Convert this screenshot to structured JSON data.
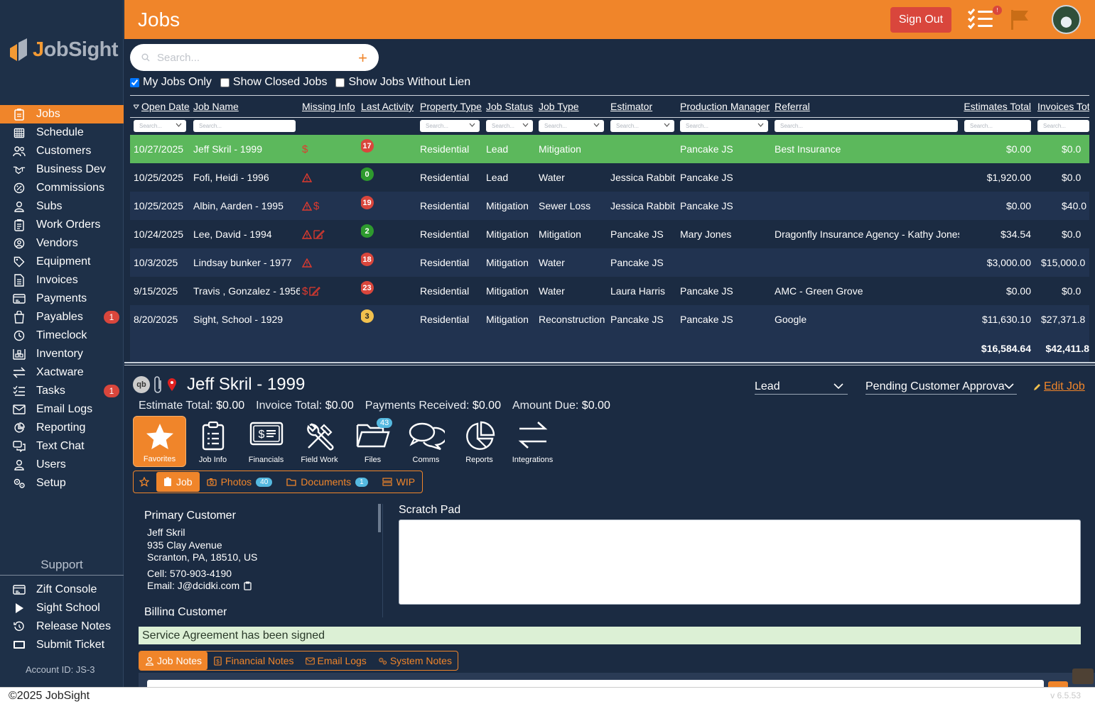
{
  "app": {
    "logo_text": "JobSight",
    "page_title": "Jobs"
  },
  "header": {
    "sign_out": "Sign Out",
    "tasks_badge": "!"
  },
  "sidebar": {
    "items": [
      {
        "label": "Jobs",
        "icon": "clipboard-icon",
        "active": true
      },
      {
        "label": "Schedule",
        "icon": "calendar-icon"
      },
      {
        "label": "Customers",
        "icon": "users-icon"
      },
      {
        "label": "Business Dev",
        "icon": "handshake-icon"
      },
      {
        "label": "Commissions",
        "icon": "percent-icon"
      },
      {
        "label": "Subs",
        "icon": "user-icon"
      },
      {
        "label": "Work Orders",
        "icon": "clipboard-list-icon"
      },
      {
        "label": "Vendors",
        "icon": "user-circle-icon"
      },
      {
        "label": "Equipment",
        "icon": "tag-icon"
      },
      {
        "label": "Invoices",
        "icon": "document-icon"
      },
      {
        "label": "Payments",
        "icon": "card-icon"
      },
      {
        "label": "Payables",
        "icon": "bag-icon",
        "badge": "1"
      },
      {
        "label": "Timeclock",
        "icon": "clock-icon"
      },
      {
        "label": "Inventory",
        "icon": "warehouse-icon"
      },
      {
        "label": "Xactware",
        "icon": "arrows-icon"
      },
      {
        "label": "Tasks",
        "icon": "list-icon",
        "badge": "1"
      },
      {
        "label": "Email Logs",
        "icon": "mail-icon"
      },
      {
        "label": "Reporting",
        "icon": "chart-pie-icon"
      },
      {
        "label": "Text Chat",
        "icon": "chat-icon"
      },
      {
        "label": "Users",
        "icon": "user-icon"
      },
      {
        "label": "Setup",
        "icon": "gears-icon"
      }
    ],
    "support_title": "Support",
    "support_items": [
      {
        "label": "Zift Console",
        "icon": "card-icon"
      },
      {
        "label": "Sight School",
        "icon": "play-icon"
      },
      {
        "label": "Release Notes",
        "icon": "history-icon"
      },
      {
        "label": "Submit Ticket",
        "icon": "monitor-icon"
      }
    ],
    "account_id": "Account ID:  JS-3"
  },
  "search": {
    "placeholder": "Search..."
  },
  "filters": [
    {
      "label": "My Jobs Only",
      "checked": true
    },
    {
      "label": "Show Closed Jobs",
      "checked": false
    },
    {
      "label": "Show Jobs Without Lien",
      "checked": false
    }
  ],
  "table": {
    "columns": [
      "Open Date",
      "Job Name",
      "Missing Info",
      "Last Activity",
      "Property Type",
      "Job Status",
      "Job Type",
      "Estimator",
      "Production Manager",
      "Referral",
      "Estimates Total",
      "Invoices Tot"
    ],
    "search_placeholder": "Search...",
    "rows": [
      {
        "date": "10/27/2025",
        "name": "Jeff Skril - 1999",
        "missing": [
          "dollar"
        ],
        "activity": "17",
        "activity_color": "#d9463c",
        "property": "Residential",
        "status": "Lead",
        "type": "Mitigation",
        "estimator": "",
        "pm": "Pancake JS",
        "referral": "Best Insurance",
        "estimates": "$0.00",
        "invoices": "$0.0",
        "selected": true
      },
      {
        "date": "10/25/2025",
        "name": "Fofi, Heidi - 1996",
        "missing": [
          "warn"
        ],
        "activity": "0",
        "activity_color": "#2e9a2e",
        "property": "Residential",
        "status": "Lead",
        "type": "Water",
        "estimator": "Jessica Rabbit",
        "pm": "Pancake JS",
        "referral": "",
        "estimates": "$1,920.00",
        "invoices": "$0.0"
      },
      {
        "date": "10/25/2025",
        "name": "Albin, Aarden - 1995",
        "missing": [
          "warn",
          "dollar"
        ],
        "activity": "19",
        "activity_color": "#d9463c",
        "property": "Residential",
        "status": "Mitigation",
        "type": "Sewer Loss",
        "estimator": "Jessica Rabbit",
        "pm": "Pancake JS",
        "referral": "",
        "estimates": "$0.00",
        "invoices": "$40.0"
      },
      {
        "date": "10/24/2025",
        "name": "Lee, David - 1994",
        "missing": [
          "warn",
          "sign"
        ],
        "activity": "2",
        "activity_color": "#2e9a2e",
        "property": "Residential",
        "status": "Mitigation",
        "type": "Mitigation",
        "estimator": "Pancake JS",
        "pm": "Mary Jones",
        "referral": "Dragonfly Insurance Agency - Kathy Jones",
        "estimates": "$34.54",
        "invoices": "$0.0"
      },
      {
        "date": "10/3/2025",
        "name": "Lindsay bunker - 1977",
        "missing": [
          "warn"
        ],
        "activity": "18",
        "activity_color": "#d9463c",
        "property": "Residential",
        "status": "Mitigation",
        "type": "Water",
        "estimator": "Pancake JS",
        "pm": "",
        "referral": "",
        "estimates": "$3,000.00",
        "invoices": "$15,000.0"
      },
      {
        "date": "9/15/2025",
        "name": "Travis , Gonzalez - 1956",
        "missing": [
          "dollar",
          "sign"
        ],
        "activity": "23",
        "activity_color": "#d9463c",
        "property": "Residential",
        "status": "Mitigation",
        "type": "Water",
        "estimator": "Laura Harris",
        "pm": "Pancake JS",
        "referral": "AMC - Green Grove",
        "estimates": "$0.00",
        "invoices": "$0.0"
      },
      {
        "date": "8/20/2025",
        "name": "Sight, School - 1929",
        "missing": [],
        "activity": "3",
        "activity_color": "#f2c14e",
        "property": "Residential",
        "status": "Mitigation",
        "type": "Reconstruction",
        "estimator": "Pancake JS",
        "pm": "Pancake JS",
        "referral": "Google",
        "estimates": "$11,630.10",
        "invoices": "$27,371.8"
      }
    ],
    "totals": {
      "estimates": "$16,584.64",
      "invoices": "$42,411.8"
    }
  },
  "detail": {
    "title": "Jeff Skril - 1999",
    "status": "Lead",
    "substatus": "Pending Customer Approva",
    "edit_job": "Edit Job",
    "money": [
      {
        "label": "Estimate Total:",
        "value": "$0.00"
      },
      {
        "label": "Invoice Total:",
        "value": "$0.00"
      },
      {
        "label": "Payments Received:",
        "value": "$0.00"
      },
      {
        "label": "Amount Due:",
        "value": "$0.00"
      }
    ],
    "icon_tabs": [
      {
        "label": "Favorites",
        "icon": "star-icon"
      },
      {
        "label": "Job Info",
        "icon": "clipboard-icon"
      },
      {
        "label": "Financials",
        "icon": "money-icon"
      },
      {
        "label": "Field Work",
        "icon": "tools-icon"
      },
      {
        "label": "Files",
        "icon": "folder-icon",
        "badge": "43"
      },
      {
        "label": "Comms",
        "icon": "chat-icon"
      },
      {
        "label": "Reports",
        "icon": "chart-pie-icon"
      },
      {
        "label": "Integrations",
        "icon": "arrows-icon"
      }
    ],
    "sub_tabs": [
      {
        "label": "Job",
        "active": true
      },
      {
        "label": "Photos",
        "count": "40"
      },
      {
        "label": "Documents",
        "count": "1"
      },
      {
        "label": "WIP"
      }
    ],
    "primary_customer": {
      "title": "Primary Customer",
      "name": "Jeff Skril",
      "address1": "935 Clay Avenue",
      "address2": "Scranton, PA, 18510, US",
      "cell": "Cell: 570-903-4190",
      "email": "Email: J@dcidki.com"
    },
    "billing_title": "Billing Customer",
    "scratch_label": "Scratch Pad",
    "agreement": "Service Agreement has been signed",
    "note_tabs": [
      {
        "label": "Job Notes",
        "icon": "user-icon",
        "active": true
      },
      {
        "label": "Financial Notes",
        "icon": "dollar-icon"
      },
      {
        "label": "Email Logs",
        "icon": "mail-icon"
      },
      {
        "label": "System Notes",
        "icon": "gears-icon"
      }
    ]
  },
  "footer": {
    "copyright": "©2025 JobSight",
    "version": "v 6.5.53"
  }
}
